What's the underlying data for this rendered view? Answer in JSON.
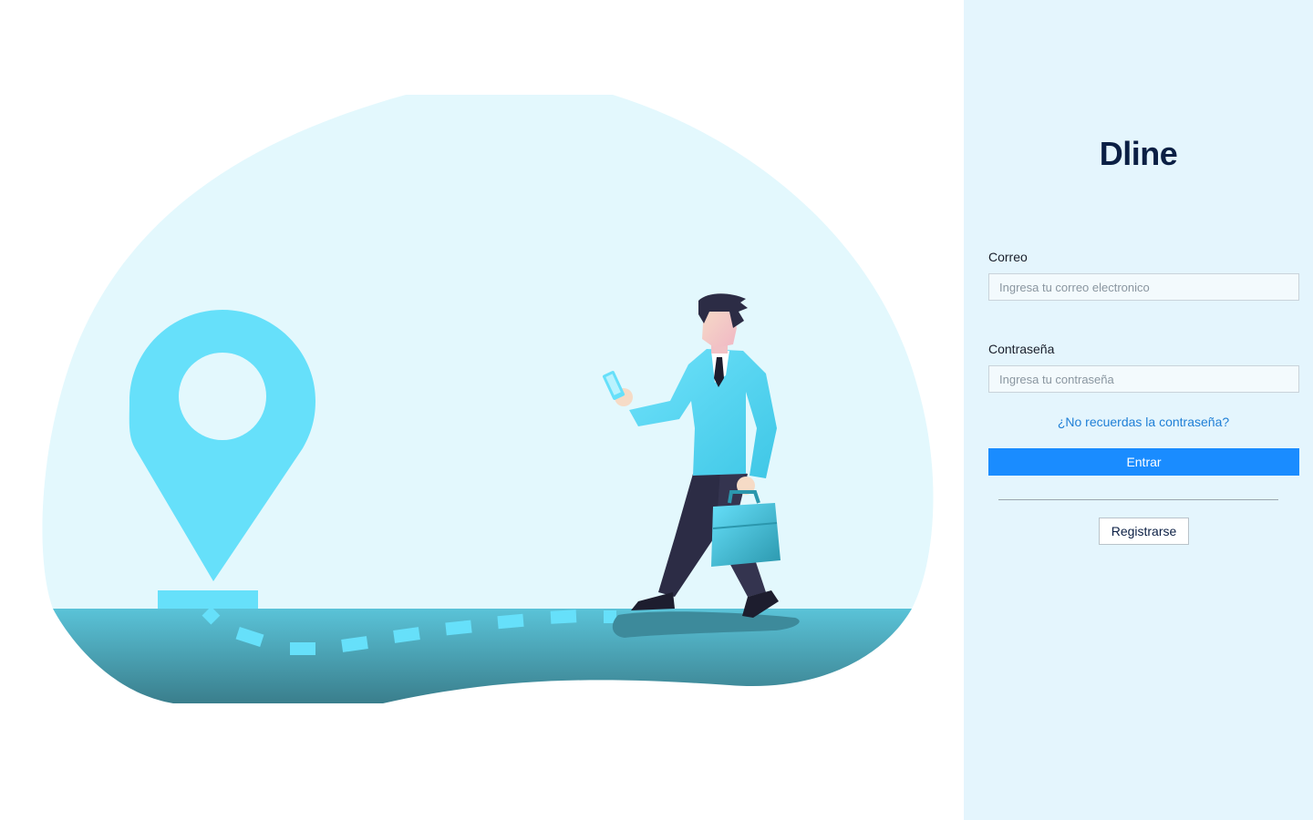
{
  "brand": {
    "name": "Dline"
  },
  "login_form": {
    "email_label": "Correo",
    "email_placeholder": "Ingresa tu correo electronico",
    "email_value": "",
    "password_label": "Contraseña",
    "password_placeholder": "Ingresa tu contraseña",
    "password_value": "",
    "forgot_password_link": "¿No recuerdas la contraseña?",
    "submit_label": "Entrar",
    "register_label": "Registrarse"
  },
  "illustration": {
    "scene": "person-walking-to-location-pin",
    "icons": [
      "location-pin-icon",
      "smartphone-icon",
      "briefcase-icon"
    ]
  },
  "colors": {
    "panel_background": "#e4f5fd",
    "primary_button": "#1a8cff",
    "link": "#1f7fd6",
    "brand_text": "#0b1f44",
    "pin": "#66e0fa",
    "blob": "#e3f8fd",
    "ground": "#4fb3c8"
  }
}
